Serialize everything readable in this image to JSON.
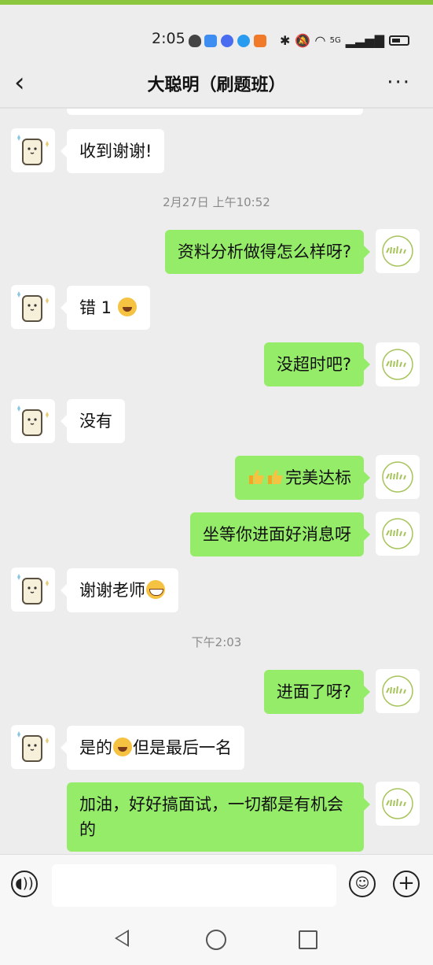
{
  "status_bar": {
    "time": "2:05",
    "network": "5G"
  },
  "chat": {
    "title": "大聪明（刷题班）"
  },
  "messages": [
    {
      "side": "in",
      "text": "收到谢谢!"
    },
    {
      "type": "time",
      "text": "2月27日 上午10:52"
    },
    {
      "side": "out",
      "text": "资料分析做得怎么样呀?"
    },
    {
      "side": "in",
      "text": "错 1",
      "emoji_after": "laugh-cry-emoji"
    },
    {
      "side": "out",
      "text": "没超时吧?"
    },
    {
      "side": "in",
      "text": "没有"
    },
    {
      "side": "out",
      "text": "完美达标",
      "emoji_before": "thumbs-up-emoji x2"
    },
    {
      "side": "out",
      "text": "坐等你进面好消息呀"
    },
    {
      "side": "in",
      "text": "谢谢老师",
      "emoji_after": "grin-emoji"
    },
    {
      "type": "time",
      "text": "下午2:03"
    },
    {
      "side": "out",
      "text": "进面了呀?"
    },
    {
      "side": "in",
      "text_before": "是的",
      "text_after": "但是最后一名",
      "emoji_mid": "laugh-cry-emoji"
    },
    {
      "side": "out",
      "text": "加油，好好搞面试，一切都是有机会的"
    }
  ],
  "theme": {
    "accent": "#95ec69",
    "topline": "#8cc63f",
    "background": "#ededed"
  }
}
